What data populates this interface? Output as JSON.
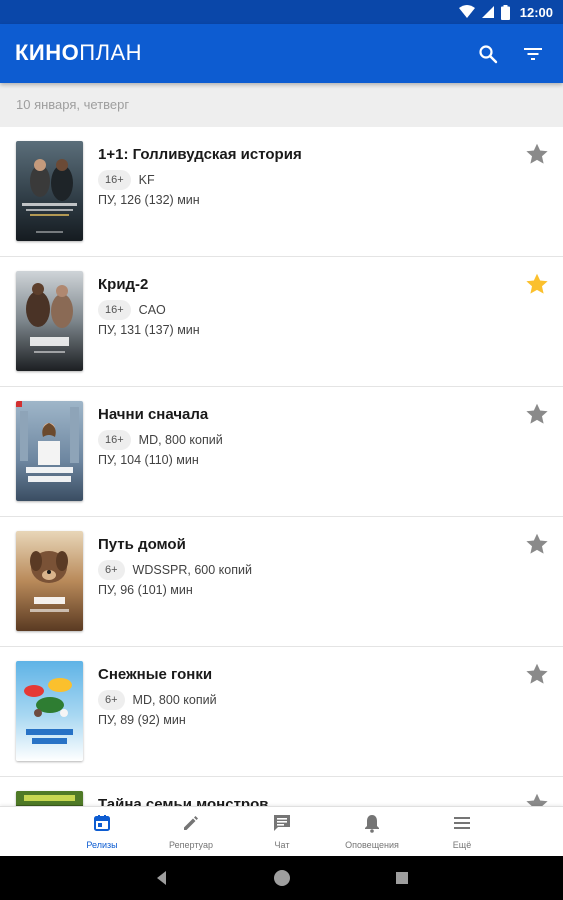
{
  "status_bar": {
    "time": "12:00"
  },
  "app_bar": {
    "logo_bold": "КИНО",
    "logo_light": "ПЛАН",
    "search_icon": "search-icon",
    "filter_icon": "filter-icon"
  },
  "date_header": {
    "label": "10 января, четверг"
  },
  "colors": {
    "primary": "#0d5cd1",
    "status_bar": "#0a47a9",
    "favorite_star": "#fbc02d",
    "inactive_star": "#8a8a8a"
  },
  "releases": [
    {
      "title": "1+1: Голливудская история",
      "age": "16+",
      "distributor": "KF",
      "duration": "ПУ, 126 (132) мин",
      "favorite": false
    },
    {
      "title": "Крид-2",
      "age": "16+",
      "distributor": "CAO",
      "duration": "ПУ, 131 (137) мин",
      "favorite": true
    },
    {
      "title": "Начни сначала",
      "age": "16+",
      "distributor": "MD, 800 копий",
      "duration": "ПУ, 104 (110) мин",
      "favorite": false
    },
    {
      "title": "Путь домой",
      "age": "6+",
      "distributor": "WDSSPR, 600 копий",
      "duration": "ПУ, 96 (101) мин",
      "favorite": false
    },
    {
      "title": "Снежные гонки",
      "age": "6+",
      "distributor": "MD, 800 копий",
      "duration": "ПУ, 89 (92) мин",
      "favorite": false
    },
    {
      "title": "Тайна семьи монстров",
      "age": "",
      "distributor": "",
      "duration": "",
      "favorite": false
    }
  ],
  "bottom_nav": {
    "items": [
      {
        "label": "Релизы",
        "icon": "calendar-icon",
        "active": true
      },
      {
        "label": "Репертуар",
        "icon": "pencil-icon",
        "active": false
      },
      {
        "label": "Чат",
        "icon": "chat-icon",
        "active": false
      },
      {
        "label": "Оповещения",
        "icon": "bell-icon",
        "active": false
      },
      {
        "label": "Ещё",
        "icon": "menu-icon",
        "active": false
      }
    ]
  }
}
